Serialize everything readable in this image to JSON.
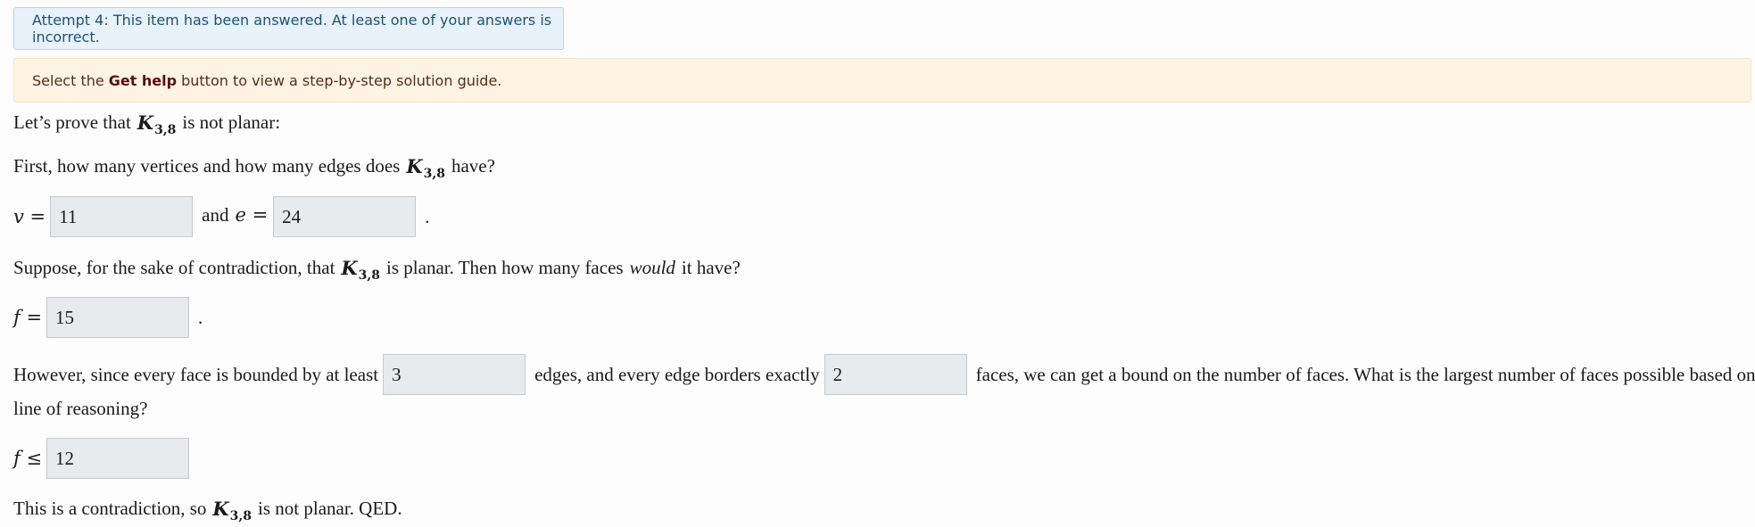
{
  "banners": {
    "attempt": "Attempt 4: This item has been answered. At least one of your answers is incorrect.",
    "help_prefix": "Select the",
    "help_bold": "Get help",
    "help_suffix": "button to view a step-by-step solution guide."
  },
  "graph": {
    "letter": "K",
    "subscript": "3,8"
  },
  "intro": {
    "prefix": "Let’s prove that",
    "suffix": "is not planar:"
  },
  "question1": {
    "prefix": "First, how many vertices and how many edges does",
    "suffix": "have?"
  },
  "row_ve": {
    "v_label": "v =",
    "v_value": "11",
    "and_text": "and",
    "e_label": "e =",
    "e_value": "24",
    "end": "."
  },
  "question2": {
    "prefix": "Suppose, for the sake of contradiction, that",
    "middle": "is planar. Then how many faces",
    "emph": "would",
    "suffix": "it have?"
  },
  "row_f": {
    "f_label": "f =",
    "f_value": "15",
    "end": "."
  },
  "question3": {
    "part1": "However, since every face is bounded by at least",
    "value1": "3",
    "part2": "edges, and every edge borders exactly",
    "value2": "2",
    "part3": "faces, we can get a bound on the number of faces. What is the largest number of faces possible based on this",
    "part4": "line of reasoning?"
  },
  "row_fmax": {
    "f_label": "f ≤",
    "f_value": "12"
  },
  "conclusion": {
    "prefix": "This is a contradiction, so",
    "suffix": "is not planar. QED."
  }
}
